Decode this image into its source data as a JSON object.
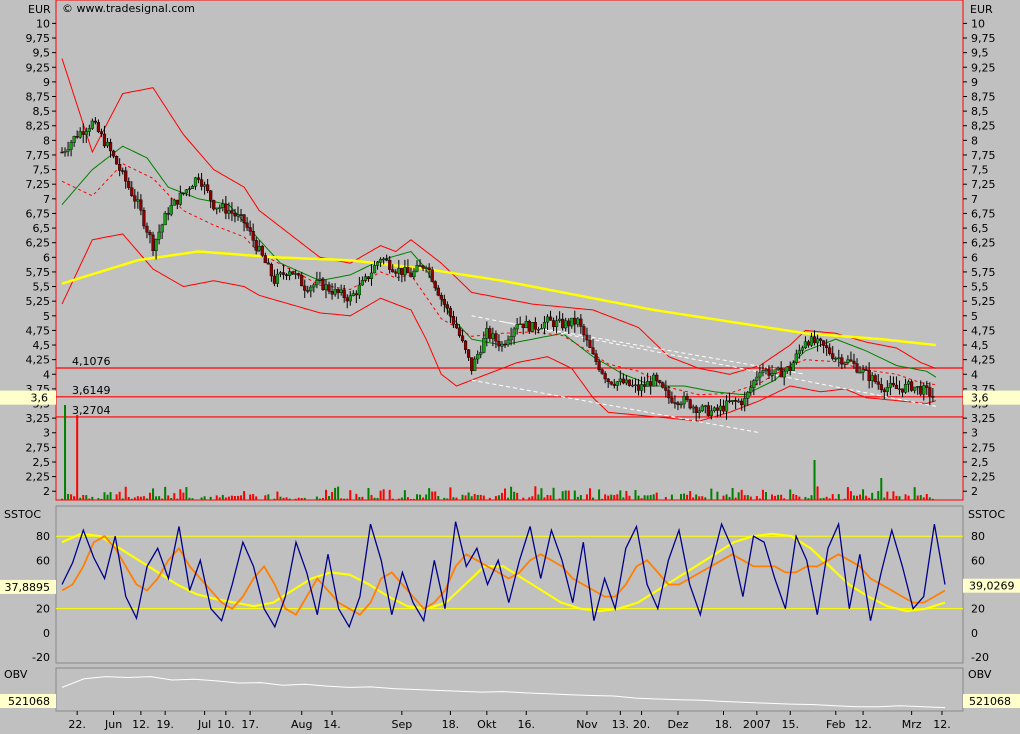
{
  "source": "© www.tradesignal.com",
  "currency": "EUR",
  "colors": {
    "background": "#c0c0c0",
    "bull_candle": "#1a9e1a",
    "bear_candle": "#8b0000",
    "bollinger": "#ff0000",
    "moving_avg_long": "#ffff00",
    "green_band": "#008000",
    "stoch_fast": "#00008b",
    "stoch_slow": "#ff7f00",
    "stoch_signal": "#ffff00",
    "obv": "#ffffff"
  },
  "chart_data": [
    {
      "panel": "price",
      "type": "candlestick",
      "ylabel": "EUR",
      "ylim": [
        1.85,
        10.4
      ],
      "yticks": [
        "2",
        "2,25",
        "2,5",
        "2,75",
        "3",
        "3,25",
        "3,5",
        "3,75",
        "4",
        "4,25",
        "4,5",
        "4,75",
        "5",
        "5,25",
        "5,5",
        "5,75",
        "6",
        "6,25",
        "6,5",
        "6,75",
        "7",
        "7,25",
        "7,5",
        "7,75",
        "8",
        "8,25",
        "8,5",
        "8,75",
        "9",
        "9,25",
        "9,5",
        "9,75",
        "10"
      ],
      "ytick_values": [
        2,
        2.25,
        2.5,
        2.75,
        3,
        3.25,
        3.5,
        3.75,
        4,
        4.25,
        4.5,
        4.75,
        5,
        5.25,
        5.5,
        5.75,
        6,
        6.25,
        6.5,
        6.75,
        7,
        7.25,
        7.5,
        7.75,
        8,
        8.25,
        8.5,
        8.75,
        9,
        9.25,
        9.5,
        9.75,
        10
      ],
      "horizontal_lines": [
        {
          "label": "4,1076",
          "value": 4.1076
        },
        {
          "label": "3,6149",
          "value": 3.6149
        },
        {
          "label": "3,2704",
          "value": 3.2704
        }
      ],
      "last_price": {
        "label": "3,6",
        "value": 3.6
      },
      "close_path": [
        [
          0,
          7.8
        ],
        [
          5,
          8.1
        ],
        [
          10,
          8.3
        ],
        [
          15,
          7.9
        ],
        [
          20,
          7.4
        ],
        [
          25,
          6.9
        ],
        [
          30,
          6.2
        ],
        [
          35,
          6.8
        ],
        [
          40,
          7.1
        ],
        [
          45,
          7.4
        ],
        [
          50,
          6.9
        ],
        [
          55,
          6.8
        ],
        [
          60,
          6.6
        ],
        [
          65,
          6.1
        ],
        [
          70,
          5.6
        ],
        [
          75,
          5.8
        ],
        [
          80,
          5.5
        ],
        [
          85,
          5.55
        ],
        [
          90,
          5.4
        ],
        [
          95,
          5.3
        ],
        [
          100,
          5.6
        ],
        [
          105,
          6.0
        ],
        [
          110,
          5.8
        ],
        [
          115,
          5.7
        ],
        [
          120,
          5.9
        ],
        [
          125,
          5.3
        ],
        [
          130,
          4.8
        ],
        [
          135,
          4.1
        ],
        [
          140,
          4.7
        ],
        [
          145,
          4.5
        ],
        [
          150,
          4.9
        ],
        [
          155,
          4.8
        ],
        [
          160,
          4.9
        ],
        [
          165,
          4.85
        ],
        [
          170,
          4.9
        ],
        [
          175,
          4.3
        ],
        [
          180,
          3.9
        ],
        [
          185,
          3.85
        ],
        [
          190,
          3.75
        ],
        [
          195,
          3.9
        ],
        [
          200,
          3.6
        ],
        [
          205,
          3.55
        ],
        [
          210,
          3.4
        ],
        [
          215,
          3.35
        ],
        [
          220,
          3.5
        ],
        [
          225,
          3.55
        ],
        [
          230,
          4.1
        ],
        [
          235,
          4.0
        ],
        [
          240,
          4.1
        ],
        [
          245,
          4.6
        ],
        [
          250,
          4.5
        ],
        [
          255,
          4.3
        ],
        [
          260,
          4.2
        ],
        [
          265,
          4.0
        ],
        [
          270,
          3.8
        ],
        [
          275,
          3.75
        ],
        [
          280,
          3.8
        ],
        [
          285,
          3.7
        ],
        [
          288,
          3.6
        ]
      ],
      "ma_long": [
        [
          0,
          5.55
        ],
        [
          25,
          5.95
        ],
        [
          45,
          6.1
        ],
        [
          70,
          6.0
        ],
        [
          95,
          5.95
        ],
        [
          120,
          5.8
        ],
        [
          145,
          5.6
        ],
        [
          170,
          5.35
        ],
        [
          195,
          5.1
        ],
        [
          220,
          4.9
        ],
        [
          245,
          4.7
        ],
        [
          270,
          4.6
        ],
        [
          288,
          4.5
        ]
      ],
      "boll_upper": [
        [
          0,
          9.4
        ],
        [
          10,
          7.8
        ],
        [
          20,
          8.8
        ],
        [
          30,
          8.9
        ],
        [
          40,
          8.1
        ],
        [
          50,
          7.5
        ],
        [
          60,
          7.2
        ],
        [
          65,
          6.8
        ],
        [
          75,
          6.4
        ],
        [
          85,
          6.0
        ],
        [
          95,
          5.9
        ],
        [
          105,
          6.2
        ],
        [
          110,
          6.1
        ],
        [
          115,
          6.3
        ],
        [
          125,
          5.9
        ],
        [
          135,
          5.4
        ],
        [
          145,
          5.3
        ],
        [
          155,
          5.2
        ],
        [
          165,
          5.15
        ],
        [
          175,
          5.1
        ],
        [
          180,
          5.0
        ],
        [
          190,
          4.8
        ],
        [
          200,
          4.3
        ],
        [
          210,
          4.1
        ],
        [
          220,
          4.0
        ],
        [
          230,
          4.15
        ],
        [
          240,
          4.5
        ],
        [
          245,
          4.75
        ],
        [
          255,
          4.7
        ],
        [
          265,
          4.55
        ],
        [
          275,
          4.45
        ],
        [
          283,
          4.2
        ],
        [
          288,
          4.1
        ]
      ],
      "boll_lower": [
        [
          0,
          5.2
        ],
        [
          10,
          6.3
        ],
        [
          20,
          6.4
        ],
        [
          30,
          5.8
        ],
        [
          40,
          5.5
        ],
        [
          50,
          5.6
        ],
        [
          60,
          5.5
        ],
        [
          65,
          5.35
        ],
        [
          75,
          5.2
        ],
        [
          85,
          5.05
        ],
        [
          95,
          5.0
        ],
        [
          105,
          5.3
        ],
        [
          115,
          5.1
        ],
        [
          120,
          4.6
        ],
        [
          125,
          4.0
        ],
        [
          130,
          3.8
        ],
        [
          140,
          4.0
        ],
        [
          150,
          4.2
        ],
        [
          160,
          4.3
        ],
        [
          168,
          4.1
        ],
        [
          175,
          3.6
        ],
        [
          180,
          3.35
        ],
        [
          190,
          3.3
        ],
        [
          200,
          3.25
        ],
        [
          210,
          3.2
        ],
        [
          220,
          3.35
        ],
        [
          230,
          3.55
        ],
        [
          240,
          3.8
        ],
        [
          250,
          3.7
        ],
        [
          258,
          3.75
        ],
        [
          265,
          3.6
        ],
        [
          275,
          3.55
        ],
        [
          285,
          3.5
        ],
        [
          288,
          3.55
        ]
      ],
      "green_band": [
        [
          0,
          6.9
        ],
        [
          10,
          7.5
        ],
        [
          20,
          7.9
        ],
        [
          28,
          7.7
        ],
        [
          35,
          7.2
        ],
        [
          45,
          7.0
        ],
        [
          55,
          6.9
        ],
        [
          65,
          6.3
        ],
        [
          72,
          5.9
        ],
        [
          85,
          5.6
        ],
        [
          95,
          5.7
        ],
        [
          105,
          5.95
        ],
        [
          115,
          6.1
        ],
        [
          120,
          5.8
        ],
        [
          128,
          5.0
        ],
        [
          135,
          4.6
        ],
        [
          145,
          4.5
        ],
        [
          155,
          4.6
        ],
        [
          165,
          4.7
        ],
        [
          175,
          4.3
        ],
        [
          185,
          4.0
        ],
        [
          195,
          3.8
        ],
        [
          205,
          3.8
        ],
        [
          215,
          3.7
        ],
        [
          225,
          3.65
        ],
        [
          235,
          3.9
        ],
        [
          245,
          4.4
        ],
        [
          255,
          4.6
        ],
        [
          265,
          4.4
        ],
        [
          275,
          4.15
        ],
        [
          285,
          4.05
        ],
        [
          288,
          3.95
        ]
      ],
      "trend_lines": [
        [
          [
            135,
            5.0
          ],
          [
            288,
            3.45
          ]
        ],
        [
          [
            135,
            3.9
          ],
          [
            230,
            3.0
          ]
        ],
        [
          [
            145,
            4.9
          ],
          [
            245,
            4.0
          ]
        ]
      ]
    },
    {
      "panel": "stochastic",
      "type": "line",
      "title": "SSTOC",
      "ylim": [
        -25,
        105
      ],
      "yticks": [
        "80",
        "60",
        "40",
        "20",
        "0",
        "-20"
      ],
      "ytick_values": [
        80,
        60,
        40,
        20,
        0,
        -20
      ],
      "levels": [
        80,
        20
      ],
      "left_value": "37,8895",
      "right_value": "39,0269",
      "fast_values": [
        40,
        58,
        85,
        62,
        45,
        80,
        30,
        12,
        55,
        70,
        45,
        88,
        35,
        60,
        20,
        10,
        40,
        75,
        55,
        20,
        5,
        30,
        75,
        50,
        15,
        65,
        20,
        5,
        30,
        90,
        60,
        15,
        50,
        25,
        10,
        60,
        20,
        92,
        55,
        70,
        40,
        60,
        25,
        60,
        88,
        45,
        85,
        60,
        25,
        75,
        10,
        45,
        20,
        70,
        88,
        40,
        20,
        60,
        85,
        40,
        15,
        55,
        90,
        70,
        30,
        80,
        75,
        45,
        20,
        80,
        60,
        15,
        70,
        90,
        20,
        65,
        10,
        50,
        85,
        55,
        20,
        30,
        90,
        40
      ],
      "slow_values": [
        35,
        40,
        55,
        75,
        80,
        70,
        55,
        40,
        35,
        45,
        60,
        70,
        55,
        45,
        35,
        25,
        20,
        30,
        45,
        55,
        40,
        20,
        15,
        30,
        45,
        35,
        25,
        20,
        15,
        25,
        45,
        50,
        40,
        30,
        20,
        25,
        35,
        55,
        65,
        60,
        55,
        50,
        45,
        50,
        60,
        65,
        60,
        55,
        45,
        40,
        35,
        30,
        30,
        40,
        55,
        60,
        50,
        40,
        40,
        45,
        50,
        55,
        60,
        65,
        60,
        55,
        55,
        55,
        50,
        50,
        55,
        55,
        60,
        65,
        60,
        55,
        45,
        40,
        35,
        30,
        25,
        25,
        30,
        35
      ],
      "signal_values": [
        75,
        82,
        80,
        70,
        60,
        50,
        40,
        32,
        28,
        25,
        22,
        25,
        35,
        45,
        50,
        48,
        40,
        30,
        22,
        20,
        25,
        40,
        55,
        55,
        45,
        35,
        25,
        20,
        18,
        20,
        25,
        35,
        45,
        55,
        65,
        75,
        80,
        82,
        80,
        70,
        55,
        40,
        30,
        22,
        18,
        20,
        25
      ]
    },
    {
      "panel": "obv",
      "type": "line",
      "title": "OBV",
      "left_value": "521068",
      "right_value": "521068",
      "values": [
        0.55,
        0.75,
        0.8,
        0.78,
        0.8,
        0.72,
        0.74,
        0.7,
        0.65,
        0.66,
        0.6,
        0.62,
        0.58,
        0.55,
        0.56,
        0.52,
        0.5,
        0.48,
        0.46,
        0.44,
        0.45,
        0.42,
        0.4,
        0.38,
        0.36,
        0.35,
        0.3,
        0.28,
        0.26,
        0.25,
        0.22,
        0.2,
        0.18,
        0.16,
        0.15,
        0.12,
        0.1,
        0.1,
        0.12,
        0.1,
        0.08
      ]
    }
  ],
  "x_axis": {
    "labels": [
      {
        "text": "22.",
        "idx": 5
      },
      {
        "text": "Jun",
        "idx": 17
      },
      {
        "text": "12.",
        "idx": 26
      },
      {
        "text": "19.",
        "idx": 34
      },
      {
        "text": "Jul",
        "idx": 47
      },
      {
        "text": "10.",
        "idx": 54
      },
      {
        "text": "17.",
        "idx": 62
      },
      {
        "text": "Aug",
        "idx": 79
      },
      {
        "text": "14.",
        "idx": 89
      },
      {
        "text": "Sep",
        "idx": 112
      },
      {
        "text": "18.",
        "idx": 128
      },
      {
        "text": "Okt",
        "idx": 140
      },
      {
        "text": "16.",
        "idx": 153
      },
      {
        "text": "Nov",
        "idx": 173
      },
      {
        "text": "13.",
        "idx": 184
      },
      {
        "text": "20.",
        "idx": 191
      },
      {
        "text": "Dez",
        "idx": 203
      },
      {
        "text": "18.",
        "idx": 218
      },
      {
        "text": "2007",
        "idx": 229
      },
      {
        "text": "15.",
        "idx": 240
      },
      {
        "text": "Feb",
        "idx": 255
      },
      {
        "text": "12.",
        "idx": 264
      },
      {
        "text": "Mrz",
        "idx": 280
      },
      {
        "text": "12.",
        "idx": 290
      }
    ]
  }
}
